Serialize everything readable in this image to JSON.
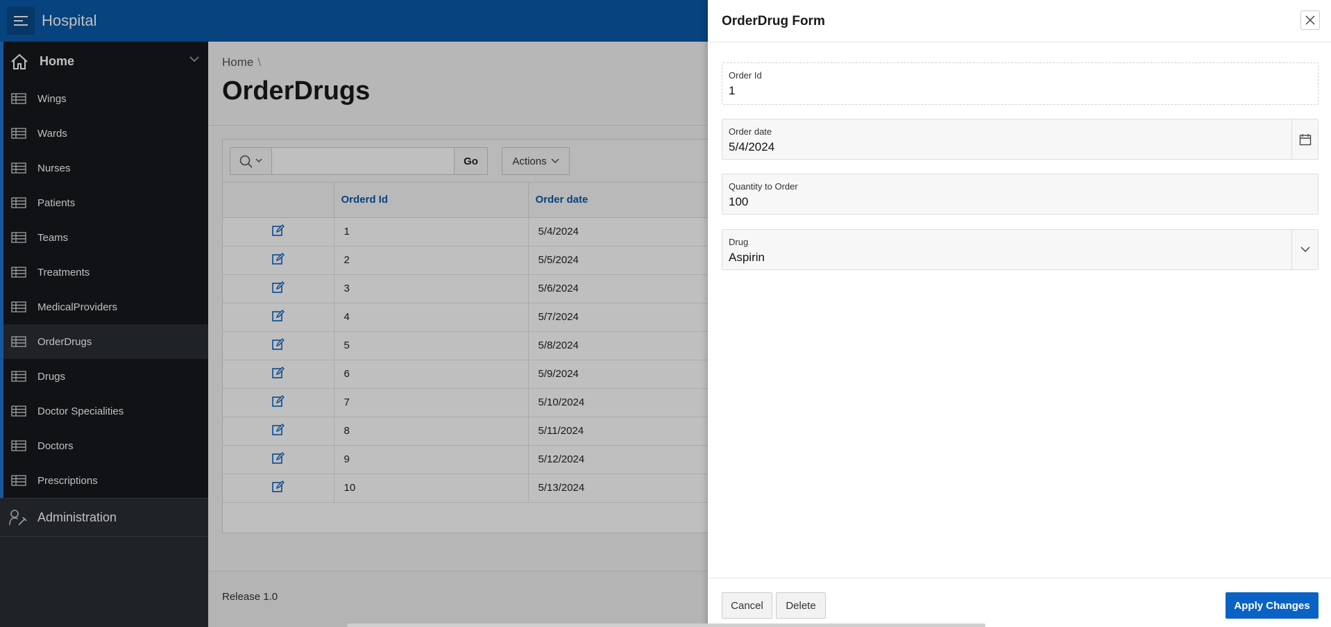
{
  "header": {
    "app_title": "Hospital"
  },
  "sidebar": {
    "home_label": "Home",
    "items": [
      {
        "label": "Wings"
      },
      {
        "label": "Wards"
      },
      {
        "label": "Nurses"
      },
      {
        "label": "Patients"
      },
      {
        "label": "Teams"
      },
      {
        "label": "Treatments"
      },
      {
        "label": "MedicalProviders"
      },
      {
        "label": "OrderDrugs"
      },
      {
        "label": "Drugs"
      },
      {
        "label": "Doctor Specialities"
      },
      {
        "label": "Doctors"
      },
      {
        "label": "Prescriptions"
      }
    ],
    "admin_label": "Administration"
  },
  "main": {
    "breadcrumb": "Home",
    "breadcrumb_sep": "\\",
    "title": "OrderDrugs",
    "toolbar": {
      "go_label": "Go",
      "actions_label": "Actions"
    },
    "columns": [
      "Orderd Id",
      "Order date"
    ],
    "rows": [
      {
        "id": "1",
        "date": "5/4/2024"
      },
      {
        "id": "2",
        "date": "5/5/2024"
      },
      {
        "id": "3",
        "date": "5/6/2024"
      },
      {
        "id": "4",
        "date": "5/7/2024"
      },
      {
        "id": "5",
        "date": "5/8/2024"
      },
      {
        "id": "6",
        "date": "5/9/2024"
      },
      {
        "id": "7",
        "date": "5/10/2024"
      },
      {
        "id": "8",
        "date": "5/11/2024"
      },
      {
        "id": "9",
        "date": "5/12/2024"
      },
      {
        "id": "10",
        "date": "5/13/2024"
      }
    ],
    "release": "Release 1.0"
  },
  "drawer": {
    "title": "OrderDrug Form",
    "fields": {
      "order_id": {
        "label": "Order Id",
        "value": "1"
      },
      "order_date": {
        "label": "Order date",
        "value": "5/4/2024"
      },
      "quantity": {
        "label": "Quantity to Order",
        "value": "100"
      },
      "drug": {
        "label": "Drug",
        "value": "Aspirin"
      }
    },
    "cancel_label": "Cancel",
    "delete_label": "Delete",
    "apply_label": "Apply Changes"
  },
  "colors": {
    "header": "#0a5aa8",
    "sidebar": "#16181c",
    "accent": "#1e74d1",
    "primary_button": "#0a63c4"
  },
  "icons": [
    "menu-icon",
    "home-icon",
    "table-icon",
    "chevron-down-icon",
    "admin-icon",
    "search-icon",
    "edit-icon",
    "close-icon",
    "calendar-icon"
  ]
}
